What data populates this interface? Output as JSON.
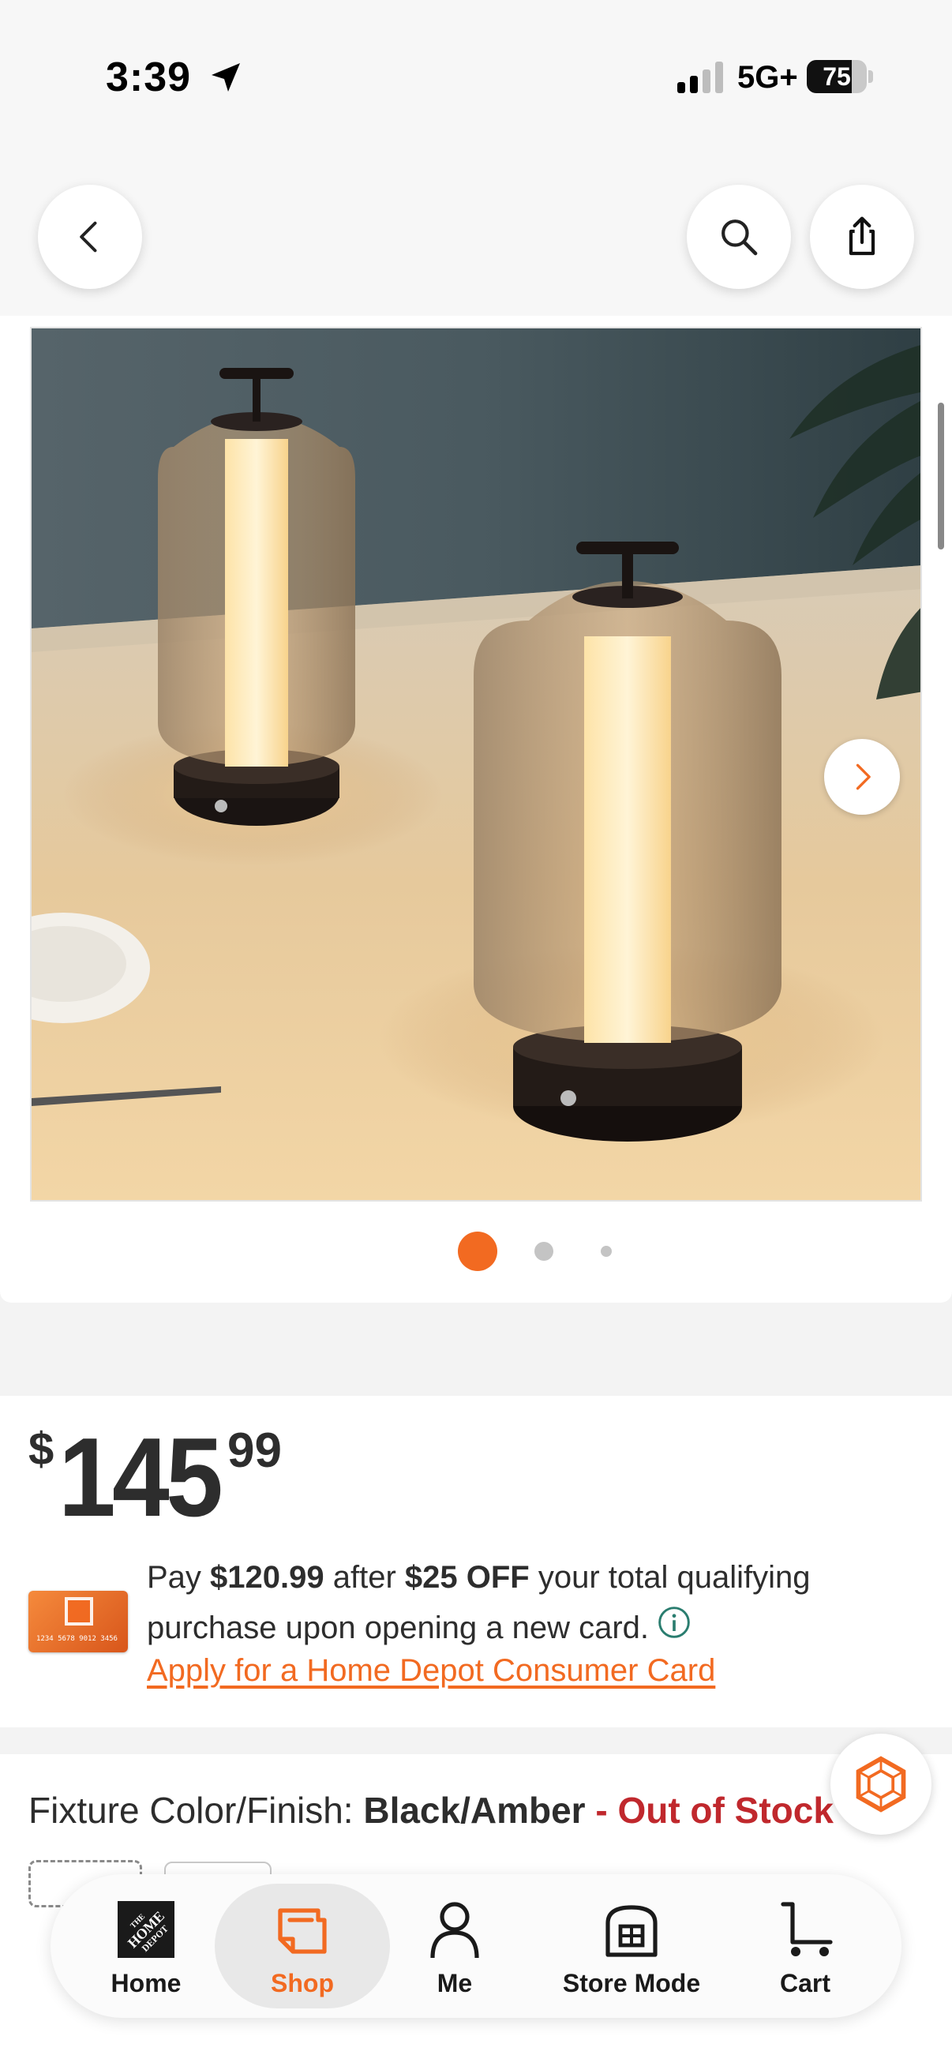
{
  "status_bar": {
    "time": "3:39",
    "network": "5G+",
    "battery_level": "75"
  },
  "nav": {
    "back_icon": "chevron-left-icon",
    "search_icon": "search-icon",
    "share_icon": "share-icon"
  },
  "gallery": {
    "image_description_icon": "lamp-photo",
    "next_icon": "chevron-right-icon",
    "image_count": 3,
    "active_index": 0
  },
  "price": {
    "dollar_sign": "$",
    "whole": "145",
    "cents": "99"
  },
  "offer": {
    "pay_prefix": "Pay ",
    "pay_amount": "$120.99",
    "after": " after ",
    "discount": "$25 OFF",
    "rest": " your total qualifying purchase upon opening a new card.",
    "apply_link": "Apply for a Home Depot Consumer Card",
    "card_number": "1234 5678 9012 3456"
  },
  "fixture": {
    "label": "Fixture Color/Finish: ",
    "value": "Black/Amber",
    "status": " - Out of Stock"
  },
  "tabs": [
    {
      "label": "Home",
      "icon": "home-depot-logo-icon"
    },
    {
      "label": "Shop",
      "icon": "shop-icon"
    },
    {
      "label": "Me",
      "icon": "person-icon"
    },
    {
      "label": "Store Mode",
      "icon": "store-icon"
    },
    {
      "label": "Cart",
      "icon": "cart-icon"
    }
  ],
  "colors": {
    "accent": "#f26a21",
    "out_of_stock": "#c0282d"
  }
}
